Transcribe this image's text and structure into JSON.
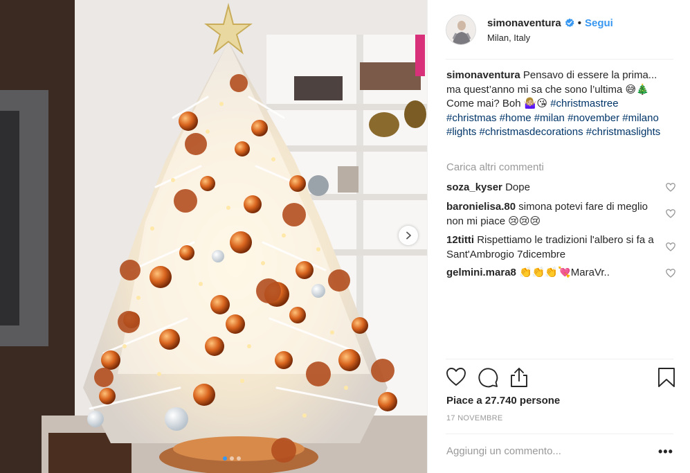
{
  "post": {
    "username": "simonaventura",
    "separator": "•",
    "follow_label": "Segui",
    "location": "Milan, Italy",
    "caption_text": "Pensavo di essere la prima... ma quest’anno mi sa che sono l’ultima 😅🎄 Come mai? Boh 🤷🏼‍♀️😘",
    "hashtags": "#christmastree #christmas #home #milan #november #milano #lights #christmasdecorations #christmaslights",
    "load_more": "Carica altri commenti",
    "likes": "Piace a 27.740 persone",
    "date": "17 NOVEMBRE",
    "add_comment_placeholder": "Aggiungi un commento...",
    "more_label": "•••"
  },
  "comments": [
    {
      "user": "soza_kyser",
      "text": "Dope"
    },
    {
      "user": "baronielisa.80",
      "text": "simona potevi fare di meglio non mi piace 😢😢😢"
    },
    {
      "user": "12titti",
      "text": "Rispettiamo le tradizioni l'albero si fa a Sant'Ambrogio 7dicembre"
    },
    {
      "user": "gelmini.mara8",
      "text": "👏👏👏💘MaraVr.."
    }
  ],
  "icons": {
    "like": "heart-outline-icon",
    "comment": "speech-bubble-icon",
    "share": "share-upload-icon",
    "save": "bookmark-icon",
    "verified": "verified-badge-icon",
    "next": "chevron-right-icon"
  },
  "colors": {
    "link_blue": "#3897f0",
    "hashtag": "#003569",
    "muted": "#999999",
    "text": "#262626"
  }
}
